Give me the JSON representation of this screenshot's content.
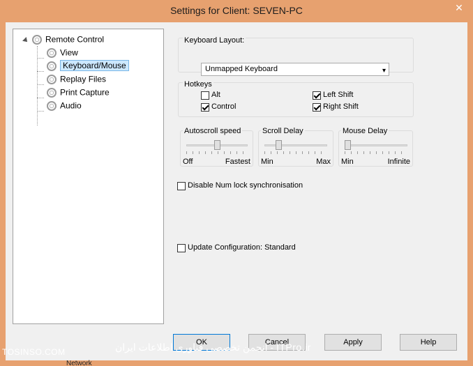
{
  "window": {
    "title": "Settings for Client: SEVEN-PC",
    "close_glyph": "✕"
  },
  "tree": {
    "root": "Remote Control",
    "items": [
      {
        "label": "View"
      },
      {
        "label": "Keyboard/Mouse",
        "selected": true
      },
      {
        "label": "Replay Files"
      },
      {
        "label": "Print Capture"
      },
      {
        "label": "Audio"
      }
    ]
  },
  "keyboard_layout": {
    "label": "Keyboard Layout:",
    "value": "Unmapped Keyboard"
  },
  "hotkeys": {
    "label": "Hotkeys",
    "alt": {
      "label": "Alt",
      "checked": false
    },
    "control": {
      "label": "Control",
      "checked": true
    },
    "left_shift": {
      "label": "Left Shift",
      "checked": true
    },
    "right_shift": {
      "label": "Right Shift",
      "checked": true
    }
  },
  "autoscroll": {
    "label": "Autoscroll speed",
    "min": "Off",
    "max": "Fastest",
    "level": 0.5
  },
  "scroll_delay": {
    "label": "Scroll Delay",
    "min": "Min",
    "max": "Max",
    "level": 0.2
  },
  "mouse_delay": {
    "label": "Mouse Delay",
    "min": "Min",
    "max": "Infinite",
    "level": 0.0
  },
  "numlock": {
    "label": "Disable Num lock synchronisation",
    "checked": false
  },
  "update_config": {
    "label": "Update Configuration: Standard",
    "checked": false
  },
  "buttons": {
    "ok": "OK",
    "cancel": "Cancel",
    "apply": "Apply",
    "help": "Help"
  },
  "watermark": {
    "left": "TOSINSO.COM",
    "mid": "انجمن تخصصی فناوری اطلاعات ایران - ITPro.ir"
  },
  "taskbar": {
    "text": "Network"
  }
}
